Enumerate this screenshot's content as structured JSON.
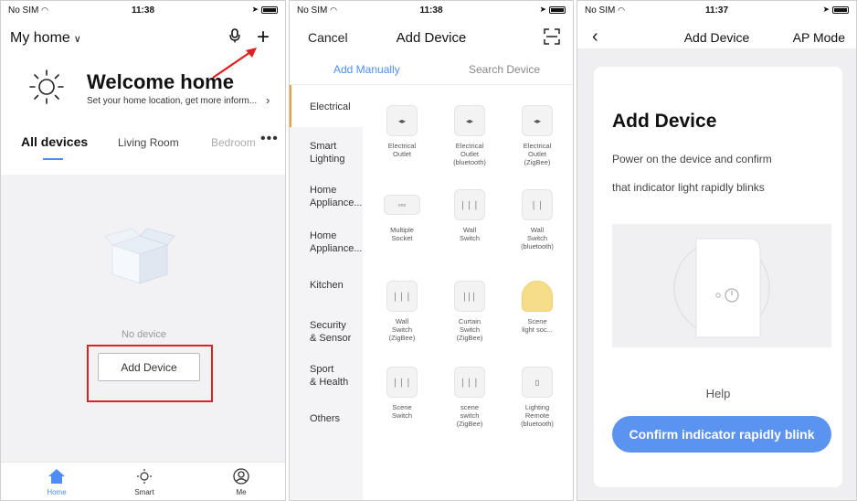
{
  "panel1": {
    "status": {
      "carrier": "No SIM",
      "time": "11:38"
    },
    "home_selector": "My home",
    "welcome_title": "Welcome home",
    "location_prompt": "Set your home location, get more inform...",
    "tabs": [
      "All devices",
      "Living Room",
      "Bedroom"
    ],
    "tab_more": "•••",
    "empty_text": "No device",
    "add_device_button": "Add Device",
    "nav": [
      {
        "label": "Home",
        "icon": "home-icon"
      },
      {
        "label": "Smart",
        "icon": "smart-sun-icon"
      },
      {
        "label": "Me",
        "icon": "profile-icon"
      }
    ],
    "accent": "#4d8df5",
    "highlight": "#e02020"
  },
  "panel2": {
    "status": {
      "carrier": "No SIM",
      "time": "11:38"
    },
    "cancel": "Cancel",
    "title": "Add Device",
    "tabs": {
      "manual": "Add Manually",
      "search": "Search Device"
    },
    "categories": [
      {
        "line1": "Electrical",
        "line2": ""
      },
      {
        "line1": "Smart",
        "line2": "Lighting"
      },
      {
        "line1": "Home",
        "line2": "Appliance..."
      },
      {
        "line1": "Home",
        "line2": "Appliance..."
      },
      {
        "line1": "Kitchen",
        "line2": ""
      },
      {
        "line1": "Security",
        "line2": "& Sensor"
      },
      {
        "line1": "Sport",
        "line2": "& Health"
      },
      {
        "line1": "Others",
        "line2": ""
      }
    ],
    "devices": [
      {
        "l1": "Electrical",
        "l2": "Outlet",
        "l3": ""
      },
      {
        "l1": "Electrical",
        "l2": "Outlet",
        "l3": "(bluetooth)"
      },
      {
        "l1": "Electrical",
        "l2": "Outlet",
        "l3": "(ZigBee)"
      },
      {
        "l1": "Multiple",
        "l2": "Socket",
        "l3": ""
      },
      {
        "l1": "Wall",
        "l2": "Switch",
        "l3": ""
      },
      {
        "l1": "Wall",
        "l2": "Switch",
        "l3": "(bluetooth)"
      },
      {
        "l1": "Wall",
        "l2": "Switch",
        "l3": "(ZigBee)"
      },
      {
        "l1": "Curtain",
        "l2": "Switch",
        "l3": "(ZigBee)"
      },
      {
        "l1": "Scene",
        "l2": "light soc...",
        "l3": ""
      },
      {
        "l1": "Scene",
        "l2": "Switch",
        "l3": ""
      },
      {
        "l1": "scene",
        "l2": "switch",
        "l3": "(ZigBee)"
      },
      {
        "l1": "Lighting",
        "l2": "Remote",
        "l3": "(bluetooth)"
      }
    ]
  },
  "panel3": {
    "status": {
      "carrier": "No SIM",
      "time": "11:37"
    },
    "title": "Add Device",
    "ap_mode": "AP Mode",
    "card_title": "Add Device",
    "card_desc_line1": "Power on the device and confirm",
    "card_desc_line2": "that indicator light rapidly blinks",
    "help": "Help",
    "confirm_button": "Confirm indicator rapidly blink",
    "accent": "#5b93f0"
  }
}
